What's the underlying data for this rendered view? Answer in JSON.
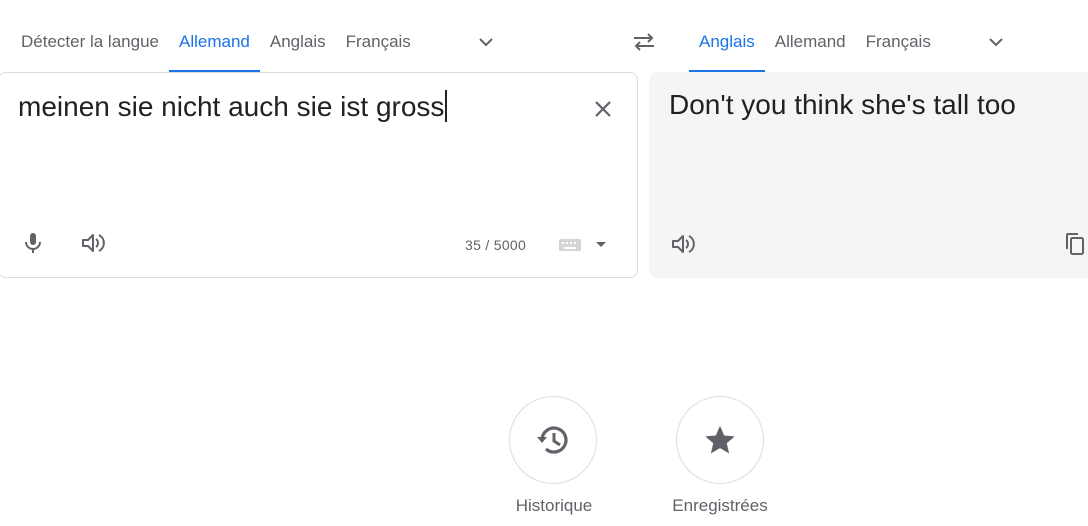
{
  "source_languages": {
    "detect": "Détecter la langue",
    "lang1": "Allemand",
    "lang2": "Anglais",
    "lang3": "Français"
  },
  "target_languages": {
    "lang1": "Anglais",
    "lang2": "Allemand",
    "lang3": "Français"
  },
  "source_panel": {
    "text": "meinen sie nicht auch sie ist gross",
    "char_count": "35 / 5000"
  },
  "target_panel": {
    "text": "Don't you think she's tall too"
  },
  "bottom": {
    "history_label": "Historique",
    "saved_label": "Enregistrées"
  },
  "colors": {
    "accent": "#1a73e8",
    "icon": "#5f6368",
    "target_bg": "#f5f5f5"
  },
  "icons": {
    "swap": "swap-arrows-icon",
    "clear": "close-icon",
    "mic": "microphone-icon",
    "speaker": "speaker-icon",
    "keyboard": "keyboard-icon",
    "copy": "copy-icon",
    "history": "history-icon",
    "saved": "star-icon"
  }
}
